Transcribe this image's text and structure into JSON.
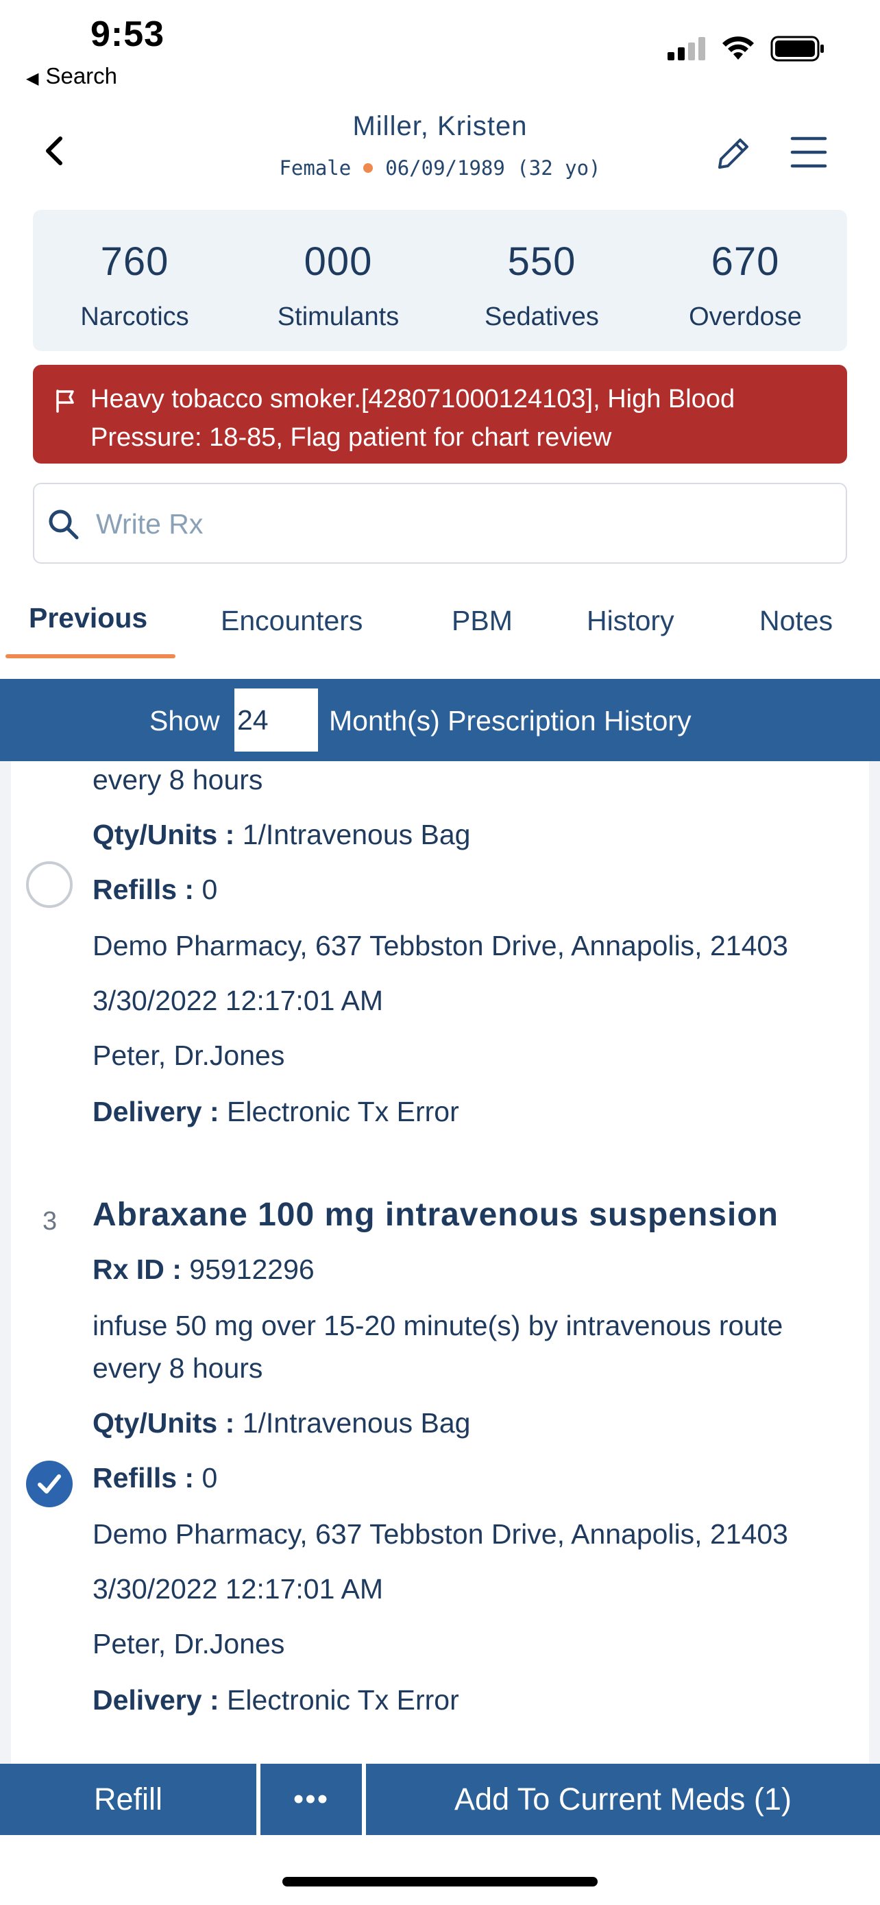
{
  "status_bar": {
    "time": "9:53",
    "back_label": "Search",
    "back_glyph": "◀",
    "icons": [
      "cellular-signal-icon",
      "wifi-icon",
      "battery-icon"
    ]
  },
  "header": {
    "patient_name": "Miller, Kristen",
    "gender": "Female",
    "dob": "06/09/1989 (32 yo)",
    "icons": [
      "chevron-left-icon",
      "pencil-icon",
      "hamburger-menu-icon"
    ]
  },
  "stats": [
    {
      "value": "760",
      "label": "Narcotics"
    },
    {
      "value": "000",
      "label": "Stimulants"
    },
    {
      "value": "550",
      "label": "Sedatives"
    },
    {
      "value": "670",
      "label": "Overdose"
    }
  ],
  "alert": {
    "text": "Heavy tobacco smoker.[428071000124103], High Blood Pressure: 18-85, Flag patient for chart review",
    "icon": "flag-icon"
  },
  "search": {
    "placeholder": "Write Rx",
    "value": ""
  },
  "tabs": [
    {
      "label": "Previous",
      "active": true
    },
    {
      "label": "Encounters",
      "active": false
    },
    {
      "label": "PBM",
      "active": false
    },
    {
      "label": "History",
      "active": false
    },
    {
      "label": "Notes",
      "active": false
    }
  ],
  "history_bar": {
    "show_label": "Show",
    "months_value": "24",
    "suffix_label": "Month(s) Prescription History"
  },
  "prescriptions": [
    {
      "sig_tail": "every 8 hours",
      "qty_label": "Qty/Units :",
      "qty": "1/Intravenous Bag",
      "refills_label": "Refills :",
      "refills": "0",
      "pharmacy": "Demo Pharmacy, 637 Tebbston Drive, Annapolis, 21403",
      "datetime": "3/30/2022 12:17:01 AM",
      "prescriber": "Peter, Dr.Jones",
      "delivery_label": "Delivery :",
      "delivery": "Electronic Tx Error",
      "selected": false
    },
    {
      "number": "3",
      "title": "Abraxane 100 mg intravenous suspension",
      "rx_id_label": "Rx ID :",
      "rx_id": "95912296",
      "sig_line1": "infuse 50 mg over 15-20 minute(s) by intravenous route",
      "sig_line2": "every 8 hours",
      "qty_label": "Qty/Units :",
      "qty": "1/Intravenous Bag",
      "refills_label": "Refills :",
      "refills": "0",
      "pharmacy": "Demo Pharmacy, 637 Tebbston Drive, Annapolis, 21403",
      "datetime": "3/30/2022 12:17:01 AM",
      "prescriber": "Peter, Dr.Jones",
      "delivery_label": "Delivery :",
      "delivery": "Electronic Tx Error",
      "selected": true
    }
  ],
  "footer": {
    "refill_label": "Refill",
    "more_label": "•••",
    "add_label": "Add To Current Meds (1)"
  },
  "colors": {
    "primary": "#2b6198",
    "text": "#1f3a5f",
    "accent": "#ee8a4f",
    "alert": "#b02f2c",
    "check": "#2c65ad"
  }
}
